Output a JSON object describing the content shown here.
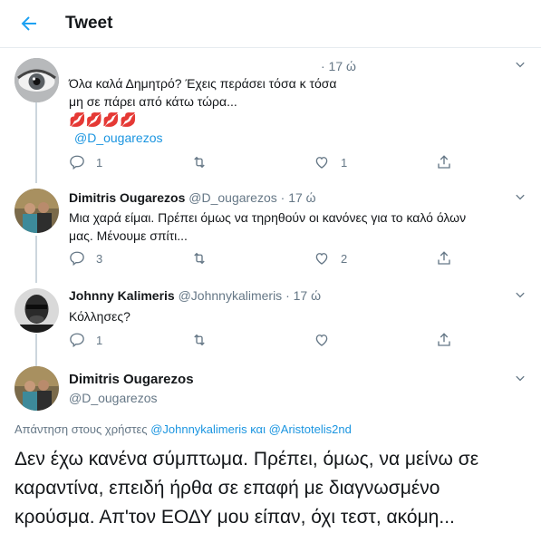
{
  "header": {
    "title": "Tweet"
  },
  "tweets": [
    {
      "name": "",
      "handle": "",
      "time": "· 17 ώ",
      "text_line1": "Όλα καλά  Δημητρό? Έχεις περάσει τόσα κ τόσα",
      "text_line2": "μη σε πάρει από κάτω τώρα...",
      "emoji": "💋💋💋💋",
      "mention": "@D_ougarezos",
      "replies": "1",
      "retweets": "",
      "likes": "1"
    },
    {
      "name": "Dimitris Ougarezos",
      "handle": "@D_ougarezos",
      "time": "· 17 ώ",
      "text_line1": "Μια χαρά είμαι. Πρέπει όμως να τηρηθούν οι κανόνες για το καλό όλων",
      "text_line2": "μας. Μένουμε σπίτι...",
      "replies": "3",
      "retweets": "",
      "likes": "2"
    },
    {
      "name": "Johnny Kalimeris",
      "handle": "@Johnnykalimeris",
      "time": "· 17 ώ",
      "text_line1": "Κόλλησες?",
      "replies": "1",
      "retweets": "",
      "likes": ""
    }
  ],
  "main": {
    "name": "Dimitris Ougarezos",
    "handle": "@D_ougarezos",
    "reply_prefix": "Απάντηση στους χρήστες",
    "reply_user1": "@Johnnykalimeris",
    "reply_and": "και",
    "reply_user2": "@Aristotelis2nd",
    "text_line1": "Δεν έχω κανένα σύμπτωμα. Πρέπει, όμως, να μείνω σε",
    "text_line2": "καραντίνα, επειδή ήρθα σε επαφή με διαγνωσμένο",
    "text_line3": "κρούσμα. Απ'τον ΕΟΔΥ μου είπαν, όχι τεστ, ακόμη..."
  },
  "colors": {
    "accent": "#1b95e0",
    "text": "#14171a",
    "muted": "#657786",
    "emoji": "#e0245e"
  },
  "icons": [
    "back-arrow-icon",
    "chevron-down-icon",
    "reply-icon",
    "retweet-icon",
    "like-icon",
    "share-icon"
  ]
}
